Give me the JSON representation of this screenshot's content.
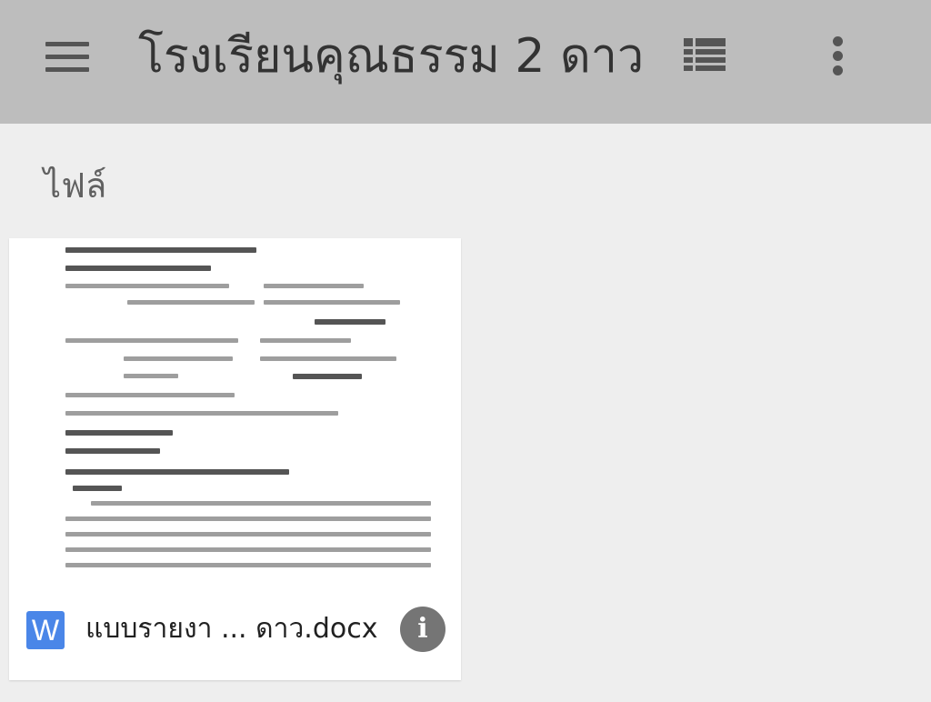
{
  "app_bar": {
    "title": "โรงเรียนคุณธรรม 2 ดาว",
    "background": "#bdbdbd",
    "menu_icon": "hamburger-menu-icon",
    "view_icon": "list-view-icon",
    "more_icon": "more-vert-icon"
  },
  "section": {
    "label": "ไฟล์"
  },
  "files": [
    {
      "name": "แบบรายงา ... ดาว.docx",
      "type_icon": "word-doc-icon",
      "type_glyph": "W",
      "type_color": "#4a86e8",
      "info_icon": "info-icon",
      "info_glyph": "i"
    }
  ]
}
